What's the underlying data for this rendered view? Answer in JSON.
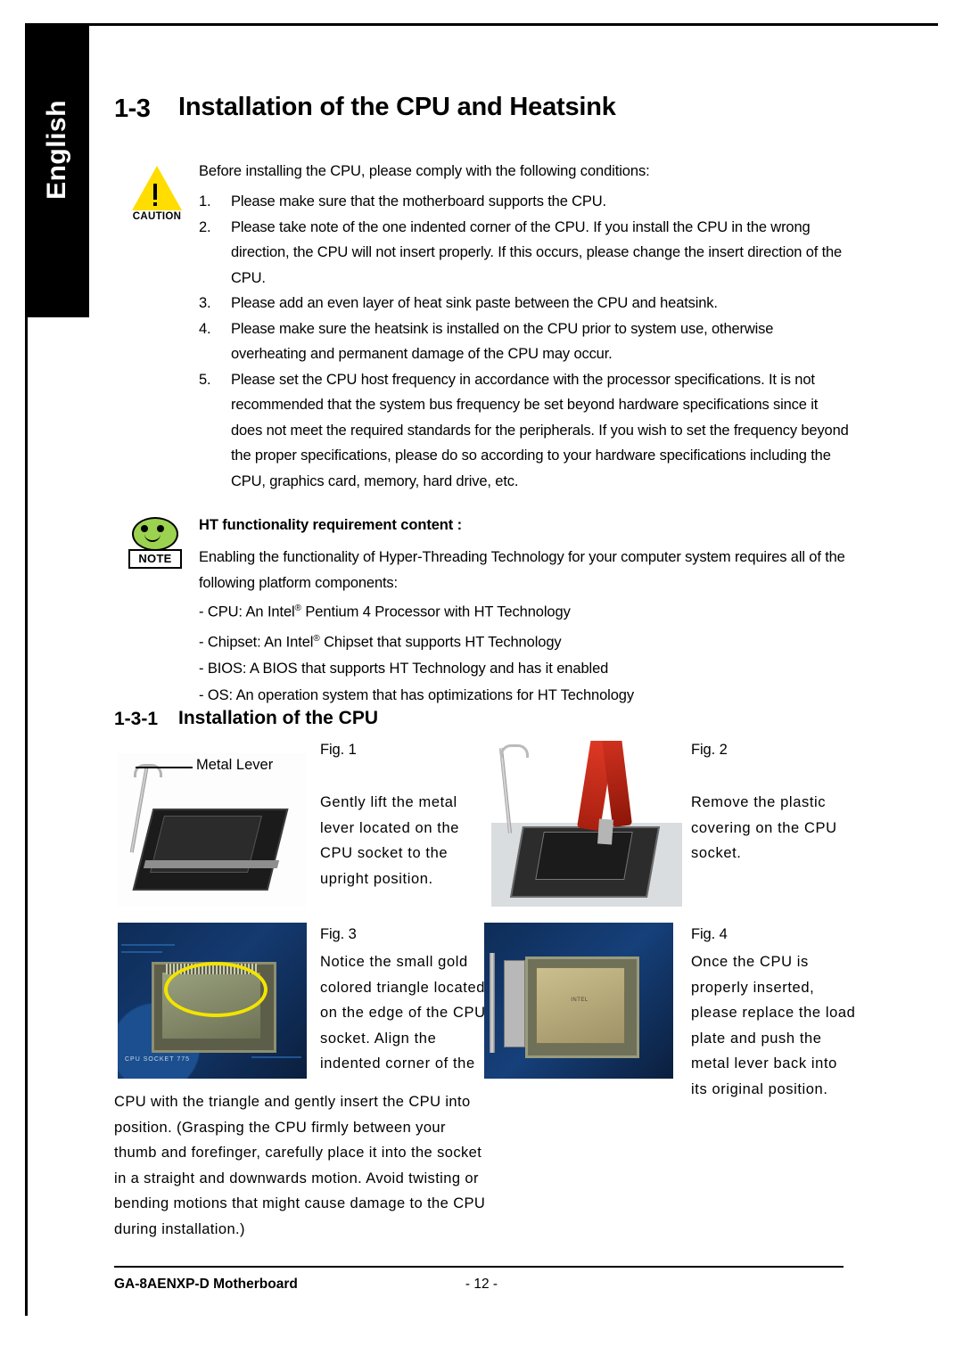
{
  "page": {
    "language_tab": "English",
    "section_number": "1-3",
    "section_title": "Installation of the CPU and Heatsink",
    "subsection_number": "1-3-1",
    "subsection_title": "Installation of the CPU",
    "footer_left": "GA-8AENXP-D Motherboard",
    "footer_page": "- 12 -"
  },
  "caution": {
    "icon": "caution-triangle-icon",
    "label": "CAUTION",
    "intro": "Before installing the CPU, please comply with the following conditions:",
    "items": [
      {
        "num": "1.",
        "text": "Please make sure that the motherboard supports the CPU."
      },
      {
        "num": "2.",
        "text": "Please take note of the one indented corner of the CPU.  If you install the CPU in the wrong direction, the CPU will not insert properly.  If this occurs, please change the insert direction of the CPU."
      },
      {
        "num": "3.",
        "text": "Please add an even layer of heat sink paste between the CPU and heatsink."
      },
      {
        "num": "4.",
        "text": "Please make sure the heatsink is installed on the CPU prior to system use, otherwise overheating and permanent damage of the CPU may occur."
      },
      {
        "num": "5.",
        "text": "Please set the CPU host frequency in accordance with the processor specifications.  It is not recommended that the system bus frequency be set beyond hardware specifications since it does not meet the required standards for the peripherals.  If you wish to set the frequency beyond the proper specifications, please do so according to your hardware specifications including the CPU, graphics card, memory, hard drive, etc."
      }
    ]
  },
  "note": {
    "icon": "note-smiley-icon",
    "label": "NOTE",
    "title": "HT functionality requirement content :",
    "body": "Enabling the functionality of Hyper-Threading Technology for your computer system requires all of the following platform components:",
    "bullets": [
      "- CPU: An Intel® Pentium 4 Processor with HT Technology",
      "- Chipset: An Intel® Chipset that supports HT Technology",
      "- BIOS: A BIOS that supports HT Technology and has it enabled",
      "- OS: An operation system that has optimizations for HT Technology"
    ],
    "bullet_parts": [
      {
        "pre": "- CPU: An Intel",
        "post": " Pentium 4 Processor with HT Technology"
      },
      {
        "pre": "- Chipset: An Intel",
        "post": " Chipset that supports HT Technology"
      }
    ]
  },
  "figures": {
    "fig1": {
      "caption": "Fig. 1",
      "callout": "Metal Lever",
      "text": "Gently lift the metal lever located on the CPU socket to the upright position."
    },
    "fig2": {
      "caption": "Fig. 2",
      "text": "Remove the plastic covering on the CPU socket."
    },
    "fig3": {
      "caption": "Fig. 3",
      "text": "Notice the small gold colored triangle located on the edge of the CPU socket.  Align the indented corner of the",
      "continuation": "CPU with the triangle and gently insert the CPU into position. (Grasping the CPU firmly between your thumb and forefinger, carefully place it into the socket in a straight and downwards motion. Avoid twisting or bending motions that might cause damage to the CPU during installation.)"
    },
    "fig4": {
      "caption": "Fig. 4",
      "text": "Once the CPU is properly inserted, please replace the load plate and push the metal lever back into its original position."
    },
    "photo_labels": {
      "pcb_silk": "CPU SOCKET 775",
      "cpu_top": "INTEL"
    }
  },
  "colors": {
    "caution_yellow": "#ffdd00",
    "note_green": "#9bd24f",
    "highlight_circle": "#f2e400",
    "pcb_blue": "#102a52"
  }
}
